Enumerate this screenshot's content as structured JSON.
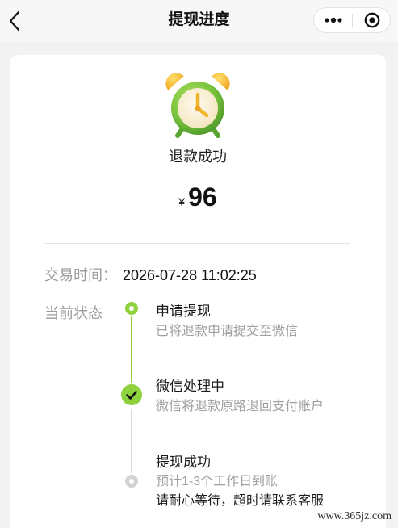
{
  "nav": {
    "title": "提现进度",
    "back_icon": "chevron-left-icon",
    "more_icon": "more-dots-icon",
    "capsule_icon": "target-circle-icon"
  },
  "result": {
    "icon": "alarm-clock-icon",
    "status": "退款成功",
    "currency": "¥",
    "amount": "96"
  },
  "info": {
    "time_label": "交易时间：",
    "time_value": "2026-07-28 11:02:25",
    "state_label": "当前状态"
  },
  "current_step": 2,
  "steps": [
    {
      "title": "申请提现",
      "desc": "已将退款申请提交至微信"
    },
    {
      "title": "微信处理中",
      "desc": "微信将退款原路退回支付账户"
    },
    {
      "title": "提现成功",
      "desc": "预计1-3个工作日到账",
      "note": "请耐心等待，超时请联系客服"
    }
  ],
  "colors": {
    "accent": "#8ed23e",
    "pending": "#d2d2d2",
    "background": "#f2f2f2",
    "card": "#ffffff",
    "text": "#1a1a1a",
    "muted": "#a0a0a0"
  },
  "watermark": "www.365jz.com"
}
